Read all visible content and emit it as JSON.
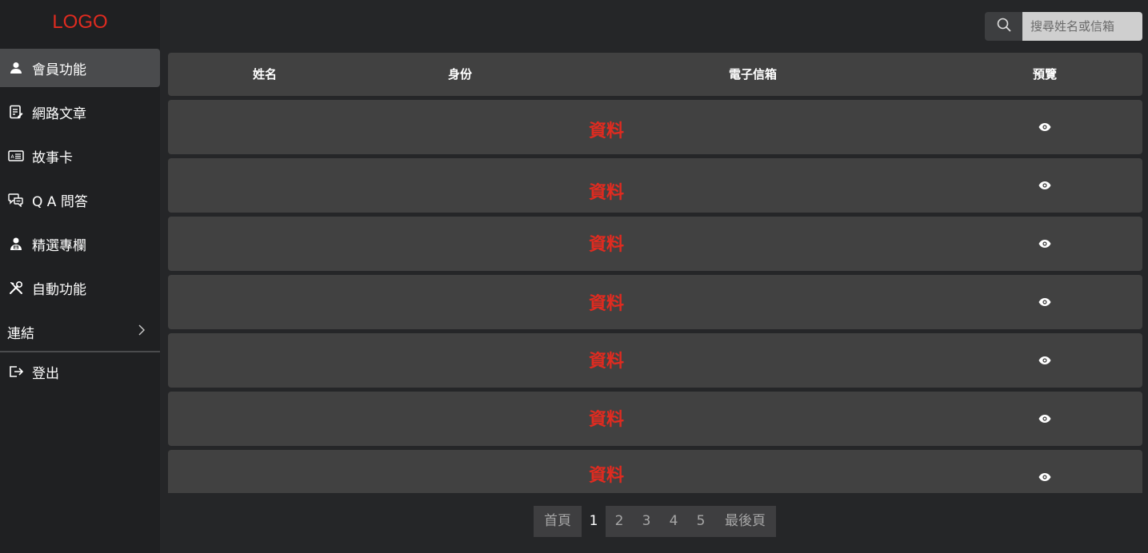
{
  "brand": {
    "logo": "LOGO",
    "logo_color": "#e02b20"
  },
  "sidebar": {
    "items": [
      {
        "label": "會員功能",
        "icon": "user-icon",
        "active": true
      },
      {
        "label": "網路文章",
        "icon": "article-icon",
        "active": false
      },
      {
        "label": "故事卡",
        "icon": "id-card-icon",
        "active": false
      },
      {
        "label": "Q A 問答",
        "icon": "chat-icon",
        "active": false
      },
      {
        "label": "精選專欄",
        "icon": "column-icon",
        "active": false
      },
      {
        "label": "自動功能",
        "icon": "tools-icon",
        "active": false
      }
    ],
    "links_label": "連結",
    "logout_label": "登出"
  },
  "search": {
    "placeholder": "搜尋姓名或信箱"
  },
  "table": {
    "headers": {
      "name": "姓名",
      "identity": "身份",
      "email": "電子信箱",
      "preview": "預覽"
    },
    "rows": [
      {
        "data": "資料"
      },
      {
        "data": "資料"
      },
      {
        "data": "資料"
      },
      {
        "data": "資料"
      },
      {
        "data": "資料"
      },
      {
        "data": "資料"
      },
      {
        "data": "資料"
      }
    ]
  },
  "pagination": {
    "first": "首頁",
    "pages": [
      "1",
      "2",
      "3",
      "4",
      "5"
    ],
    "current": "1",
    "last": "最後頁"
  },
  "colors": {
    "background": "#252628",
    "sidebar": "#1f2022",
    "row": "#414141",
    "accent_red": "#e02b20"
  }
}
